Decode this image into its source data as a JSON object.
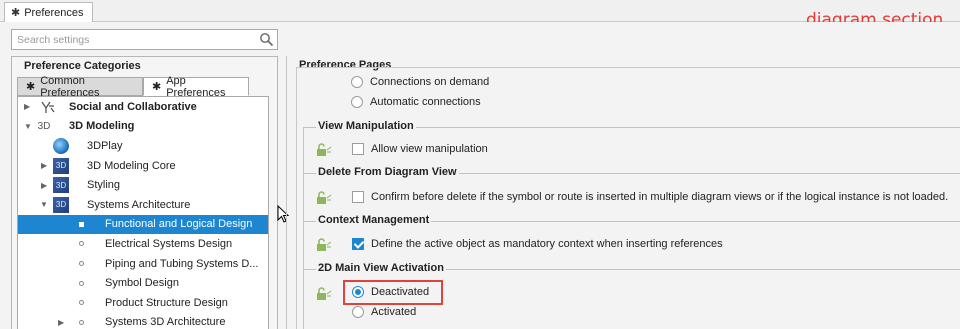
{
  "window": {
    "tab_label": "Preferences"
  },
  "annotation": "diagram section",
  "search": {
    "placeholder": "Search settings"
  },
  "left": {
    "title": "Preference Categories",
    "tabs": [
      "Common Preferences",
      "App Preferences"
    ],
    "tree": [
      {
        "label": "Social and Collaborative",
        "bold": true
      },
      {
        "label": "3D Modeling",
        "bold": true
      },
      {
        "label": "3DPlay"
      },
      {
        "label": "3D Modeling Core"
      },
      {
        "label": "Styling"
      },
      {
        "label": "Systems Architecture"
      },
      {
        "label": "Functional and Logical Design",
        "selected": true
      },
      {
        "label": "Electrical Systems Design"
      },
      {
        "label": "Piping and Tubing Systems D..."
      },
      {
        "label": "Symbol Design"
      },
      {
        "label": "Product Structure Design"
      },
      {
        "label": "Systems 3D Architecture"
      }
    ],
    "icon_3d": "3D"
  },
  "right": {
    "title": "Preference Pages",
    "connections": {
      "on_demand": "Connections on demand",
      "automatic": "Automatic connections"
    },
    "view_manipulation": {
      "title": "View Manipulation",
      "allow": "Allow view manipulation",
      "allow_checked": false
    },
    "delete_from_diagram": {
      "title": "Delete From Diagram View",
      "confirm": "Confirm before delete if the symbol or route is inserted in multiple diagram views or if the logical instance is not loaded.",
      "confirm_checked": false
    },
    "context_management": {
      "title": "Context Management",
      "define": "Define the active object as mandatory context when inserting references",
      "define_checked": true
    },
    "activation_2d": {
      "title": "2D Main View Activation",
      "deactivated": "Deactivated",
      "activated": "Activated",
      "selected": "Deactivated"
    }
  },
  "colors": {
    "accent": "#1e86d1",
    "highlight": "#e0433a",
    "annotation": "#e53935"
  }
}
